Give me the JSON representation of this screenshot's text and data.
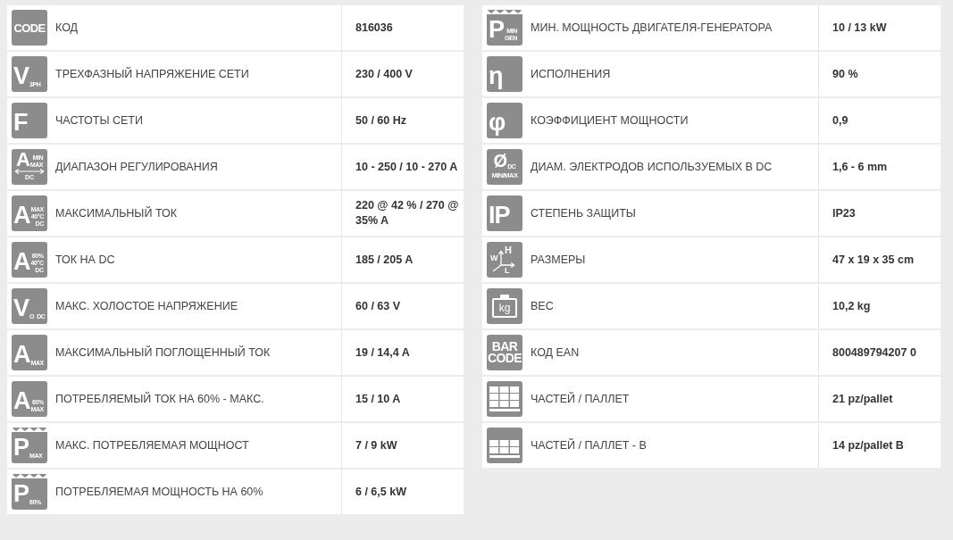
{
  "tables": [
    {
      "rows": [
        {
          "icon": {
            "kind": "word",
            "lines": [
              "CODE"
            ]
          },
          "label": "КОД",
          "value": "816036"
        },
        {
          "icon": {
            "kind": "letter",
            "main": "V",
            "sub": [
              "3PH"
            ]
          },
          "label": "ТРЕХФАЗНЫЙ НАПРЯЖЕНИЕ СЕТИ",
          "value": "230 / 400 V"
        },
        {
          "icon": {
            "kind": "letter",
            "main": "F"
          },
          "label": "ЧАСТОТЫ СЕТИ",
          "value": "50 / 60 Hz"
        },
        {
          "icon": {
            "kind": "range",
            "main": "A",
            "sub": [
              "MIN",
              "MAX"
            ],
            "bottom": "DC"
          },
          "label": "ДИАПАЗОН РЕГУЛИРОВАНИЯ",
          "value": "10 - 250 / 10 - 270 A"
        },
        {
          "icon": {
            "kind": "letter",
            "main": "A",
            "sub": [
              "MAX",
              "40°C",
              "DC"
            ]
          },
          "label": "МАКСИМАЛЬНЫЙ ТОК",
          "value": "220 @ 42 % / 270 @ 35% A"
        },
        {
          "icon": {
            "kind": "letter",
            "main": "A",
            "sub": [
              "60%",
              "40°C",
              "DC"
            ]
          },
          "label": "ТОК НА DC",
          "value": "185 / 205 A"
        },
        {
          "icon": {
            "kind": "letter",
            "main": "V",
            "sub": [
              "O  DC"
            ]
          },
          "label": "МАКС. ХОЛОСТОЕ НАПРЯЖЕНИЕ",
          "value": "60 / 63 V"
        },
        {
          "icon": {
            "kind": "letter",
            "main": "A",
            "sub": [
              "MAX"
            ]
          },
          "label": "МАКСИМАЛЬНЫЙ ПОГЛОЩЕННЫЙ ТОК",
          "value": "19 / 14,4 A"
        },
        {
          "icon": {
            "kind": "letter",
            "main": "A",
            "sub": [
              "60%",
              "MAX"
            ]
          },
          "label": "ПОТРЕБЛЯЕМЫЙ ТОК НА 60% - МАКС.",
          "value": "15 / 10 A"
        },
        {
          "icon": {
            "kind": "zigzag",
            "main": "P",
            "sub": [
              "MAX"
            ]
          },
          "label": "МАКС. ПОТРЕБЛЯЕМАЯ МОЩНОСТ",
          "value": "7 / 9 kW"
        },
        {
          "icon": {
            "kind": "zigzag",
            "main": "P",
            "sub": [
              "60%"
            ]
          },
          "label": "ПОТРЕБЛЯЕМАЯ МОЩНОСТЬ НА 60%",
          "value": "6 / 6,5 kW"
        }
      ]
    },
    {
      "rows": [
        {
          "icon": {
            "kind": "zigzag",
            "main": "P",
            "sub": [
              "MIN",
              "GEN"
            ]
          },
          "label": "МИН. МОЩНОСТЬ ДВИГАТЕЛЯ-ГЕНЕРАТОРА",
          "value": "10 / 13 kW"
        },
        {
          "icon": {
            "kind": "letter",
            "main": "η"
          },
          "label": "ИСПОЛНЕНИЯ",
          "value": "90 %"
        },
        {
          "icon": {
            "kind": "letter",
            "main": "φ"
          },
          "label": "КОЭФФИЦИЕНТ МОЩНОСТИ",
          "value": "0,9"
        },
        {
          "icon": {
            "kind": "diameter",
            "main": "Ø",
            "sub": [
              "DC"
            ],
            "bottom": "MIN/MAX"
          },
          "label": "ДИАМ. ЭЛЕКТРОДОВ ИСПОЛЬЗУЕМЫХ В DC",
          "value": "1,6 - 6 mm"
        },
        {
          "icon": {
            "kind": "letter",
            "main": "IP"
          },
          "label": "СТЕПЕНЬ ЗАЩИТЫ",
          "value": "IP23"
        },
        {
          "icon": {
            "kind": "dims",
            "lines": [
              "W",
              "H",
              "L"
            ]
          },
          "label": "РАЗМЕРЫ",
          "value": "47 x 19 x 35 cm"
        },
        {
          "icon": {
            "kind": "weight",
            "lines": [
              "kg"
            ]
          },
          "label": "ВЕС",
          "value": "10,2 kg"
        },
        {
          "icon": {
            "kind": "word",
            "lines": [
              "BAR",
              "CODE"
            ]
          },
          "label": "КОД EAN",
          "value": "800489794207 0"
        },
        {
          "icon": {
            "kind": "pallet"
          },
          "label": "ЧАСТЕЙ / ПАЛЛЕТ",
          "value": "21 pz/pallet"
        },
        {
          "icon": {
            "kind": "pallet-low"
          },
          "label": " ЧАСТЕЙ / ПАЛЛЕТ - В",
          "value": "14 pz/pallet B"
        }
      ]
    }
  ]
}
